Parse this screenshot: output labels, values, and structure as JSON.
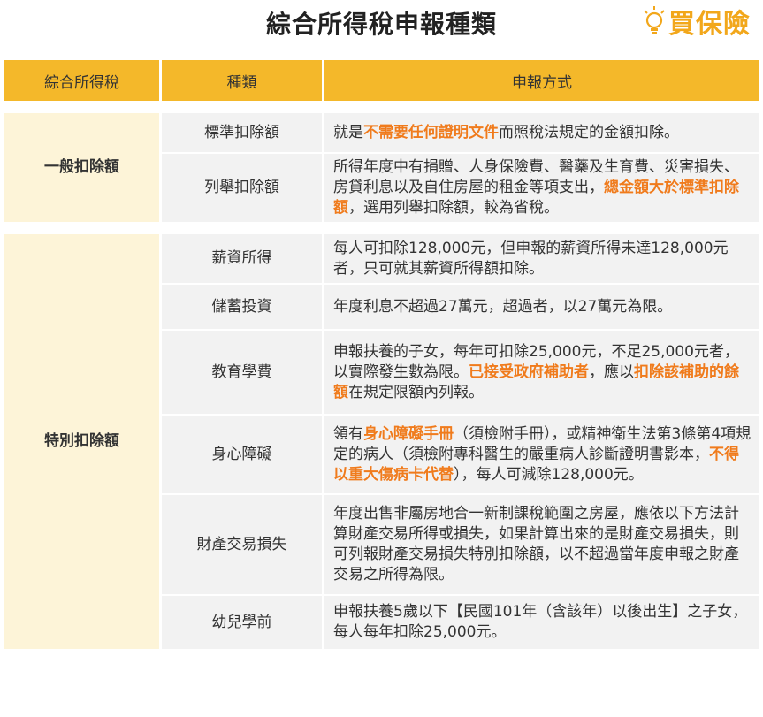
{
  "page": {
    "title": "綜合所得稅申報種類",
    "logo_text": "買保險"
  },
  "colors": {
    "header": "#f4b82a",
    "category_bg": "#fdf4d8",
    "cell_bg": "#f2f2f2",
    "highlight": "#f07b1c"
  },
  "table": {
    "headers": [
      "綜合所得稅",
      "種類",
      "申報方式"
    ],
    "groups": [
      {
        "category": "一般扣除額",
        "rows": [
          {
            "type": "標準扣除額",
            "desc": [
              {
                "t": "就是"
              },
              {
                "t": "不需要任何證明文件",
                "hl": true
              },
              {
                "t": "而照稅法規定的金額扣除。"
              }
            ]
          },
          {
            "type": "列舉扣除額",
            "desc": [
              {
                "t": "所得年度中有捐贈、人身保險費、醫藥及生育費、災害損失、房貸利息以及自住房屋的租金等項支出，"
              },
              {
                "t": "總金額大於標準扣除額",
                "hl": true
              },
              {
                "t": "，選用列舉扣除額，較為省稅。"
              }
            ]
          }
        ]
      },
      {
        "category": "特別扣除額",
        "rows": [
          {
            "type": "薪資所得",
            "desc": [
              {
                "t": "每人可扣除128,000元，但申報的薪資所得未達128,000元者，只可就其薪資所得額扣除。"
              }
            ]
          },
          {
            "type": "儲蓄投資",
            "desc": [
              {
                "t": "年度利息不超過27萬元，超過者，以27萬元為限。"
              }
            ]
          },
          {
            "type": "教育學費",
            "desc": [
              {
                "t": "申報扶養的子女，每年可扣除25,000元，不足25,000元者，以實際發生數為限。"
              },
              {
                "t": "已接受政府補助者",
                "hl": true
              },
              {
                "t": "，應以"
              },
              {
                "t": "扣除該補助的餘額",
                "hl": true
              },
              {
                "t": "在規定限額內列報。"
              }
            ]
          },
          {
            "type": "身心障礙",
            "desc": [
              {
                "t": "領有"
              },
              {
                "t": "身心障礙手冊",
                "hl": true
              },
              {
                "t": "（須檢附手冊），或精神衛生法第3條第4項規定的病人（須檢附專科醫生的嚴重病人診斷證明書影本，"
              },
              {
                "t": "不得以重大傷病卡代替",
                "hl": true
              },
              {
                "t": "），每人可減除128,000元。"
              }
            ]
          },
          {
            "type": "財產交易損失",
            "desc": [
              {
                "t": "年度出售非屬房地合一新制課稅範圍之房屋，應依以下方法計算財產交易所得或損失，如果計算出來的是財產交易損失，則可列報財產交易損失特別扣除額，以不超過當年度申報之財產交易之所得為限。"
              }
            ]
          },
          {
            "type": "幼兒學前",
            "desc": [
              {
                "t": "申報扶養5歲以下【民國101年（含該年）以後出生】之子女，每人每年扣除25,000元。"
              }
            ]
          }
        ]
      }
    ]
  }
}
